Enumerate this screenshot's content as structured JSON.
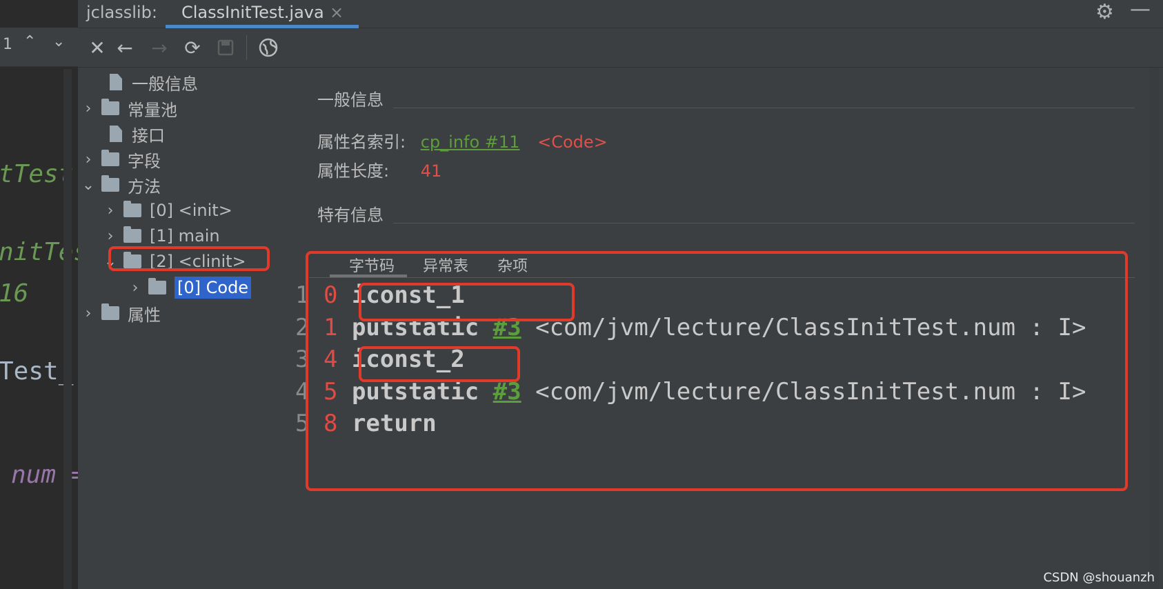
{
  "editor": {
    "line_num": "1",
    "fragments": [
      "tTest",
      "nitTes",
      "16",
      "Test_",
      "num ="
    ]
  },
  "tabbar": {
    "plugin_label": "jclasslib:",
    "active_tab": "ClassInitTest.java",
    "close_glyph": "×"
  },
  "toolbar": {
    "buttons": [
      "close-icon",
      "back-arrow-icon",
      "forward-arrow-icon",
      "refresh-icon",
      "save-icon",
      "browser-globe-icon"
    ]
  },
  "tree": {
    "items": [
      {
        "label": "一般信息",
        "icon": "file",
        "expander": ""
      },
      {
        "label": "常量池",
        "icon": "folder",
        "expander": "›"
      },
      {
        "label": "接口",
        "icon": "file",
        "expander": ""
      },
      {
        "label": "字段",
        "icon": "folder",
        "expander": "›"
      },
      {
        "label": "方法",
        "icon": "folder",
        "expander": "⌄"
      },
      {
        "label": "[0] <init>",
        "icon": "folder",
        "expander": "›"
      },
      {
        "label": "[1] main",
        "icon": "folder",
        "expander": "›"
      },
      {
        "label": "[2] <clinit>",
        "icon": "folder",
        "expander": "⌄"
      },
      {
        "label": "[0] Code",
        "icon": "folder",
        "expander": "›"
      },
      {
        "label": "属性",
        "icon": "folder",
        "expander": "›"
      }
    ]
  },
  "detail": {
    "general_title": "一般信息",
    "attr_name_label": "属性名索引:",
    "attr_name_link": "cp_info #11",
    "attr_name_value": "<Code>",
    "attr_length_label": "属性长度:",
    "attr_length_value": "41",
    "specific_title": "特有信息",
    "tabs": [
      "字节码",
      "异常表",
      "杂项"
    ],
    "bytecode": [
      {
        "line": "1",
        "offset": "0",
        "op": "iconst_1",
        "ref": "",
        "arg": ""
      },
      {
        "line": "2",
        "offset": "1",
        "op": "putstatic",
        "ref": "#3",
        "arg": "<com/jvm/lecture/ClassInitTest.num : I>"
      },
      {
        "line": "3",
        "offset": "4",
        "op": "iconst_2",
        "ref": "",
        "arg": ""
      },
      {
        "line": "4",
        "offset": "5",
        "op": "putstatic",
        "ref": "#3",
        "arg": "<com/jvm/lecture/ClassInitTest.num : I>"
      },
      {
        "line": "5",
        "offset": "8",
        "op": "return",
        "ref": "",
        "arg": ""
      }
    ]
  },
  "watermark": "CSDN @shouanzh",
  "colors": {
    "accent": "#4a88c7",
    "selection": "#2f65ca",
    "highlight_box": "#e23a2a",
    "link": "#5c9e3c",
    "value_red": "#e0504a"
  }
}
